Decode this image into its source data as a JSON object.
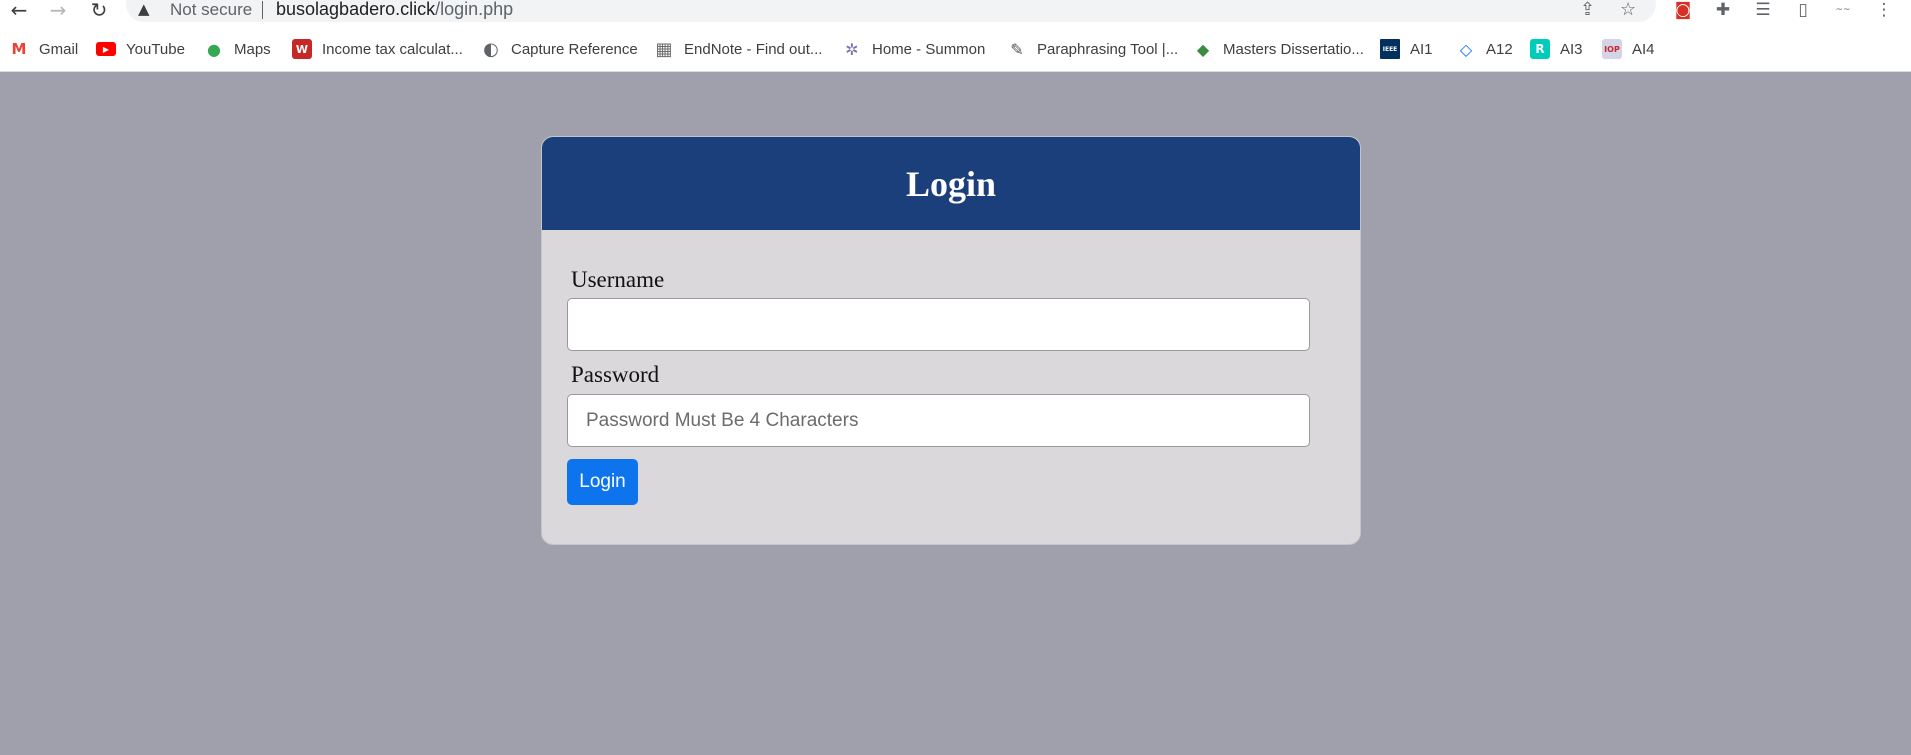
{
  "browser": {
    "status_text": "Not secure",
    "url_host": "busolagbadero.click",
    "url_path": "/login.php",
    "icons": {
      "back": "back-arrow-icon",
      "forward": "forward-arrow-icon",
      "reload": "reload-icon",
      "warning": "warning-triangle-icon",
      "share": "share-icon",
      "bookmark_star": "star-icon",
      "extension": "puzzle-icon",
      "reading_list": "reading-list-icon",
      "side_panel": "side-panel-icon",
      "menu": "kebab-menu-icon"
    }
  },
  "bookmarks": [
    {
      "label": "Gmail",
      "icon": "gmail-icon",
      "color": "#ea4335",
      "glyph": "M"
    },
    {
      "label": "YouTube",
      "icon": "youtube-icon",
      "color": "#ff0000",
      "glyph": "▶"
    },
    {
      "label": "Maps",
      "icon": "maps-pin-icon",
      "color": "#34a853",
      "glyph": "●"
    },
    {
      "label": "Income tax calculat...",
      "icon": "w-logo-icon",
      "color": "#c62828",
      "glyph": "W"
    },
    {
      "label": "Capture Reference",
      "icon": "globe-icon",
      "color": "#5f6368",
      "glyph": "◐"
    },
    {
      "label": "EndNote - Find out...",
      "icon": "endnote-icon",
      "color": "#6b6b6b",
      "glyph": "▦"
    },
    {
      "label": "Home - Summon",
      "icon": "summon-icon",
      "color": "#7b6fb0",
      "glyph": "✲"
    },
    {
      "label": "Paraphrasing Tool |...",
      "icon": "quill-icon",
      "color": "#555555",
      "glyph": "✎"
    },
    {
      "label": "Masters Dissertatio...",
      "icon": "diamond-icon",
      "color": "#3d8b3d",
      "glyph": "◆"
    },
    {
      "label": "AI1",
      "icon": "ieee-icon",
      "color": "#00305e",
      "glyph": "IEEE"
    },
    {
      "label": "A12",
      "icon": "a12-icon",
      "color": "#1a73e8",
      "glyph": "◇"
    },
    {
      "label": "AI3",
      "icon": "researchgate-icon",
      "color": "#00ccbb",
      "glyph": "R"
    },
    {
      "label": "AI4",
      "icon": "iop-icon",
      "color": "#d4d4e8",
      "glyph": "IOP"
    }
  ],
  "login": {
    "title": "Login",
    "username_label": "Username",
    "username_value": "",
    "password_label": "Password",
    "password_placeholder": "Password Must Be 4 Characters",
    "submit_label": "Login"
  },
  "colors": {
    "page_bg": "#a0a0ac",
    "header_bg": "#1a3f7a",
    "card_bg": "#dad8da",
    "button_bg": "#0d74ee"
  }
}
